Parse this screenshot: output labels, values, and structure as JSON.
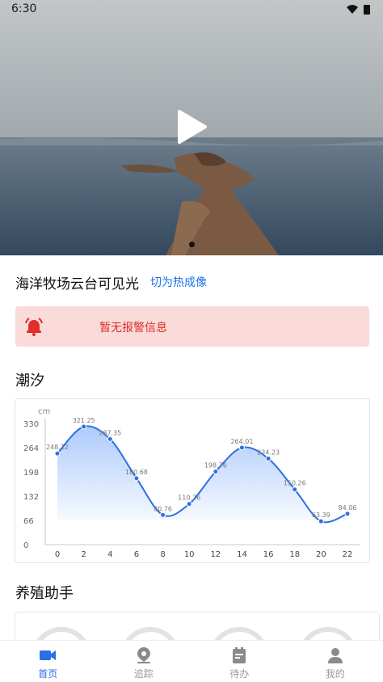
{
  "status_bar": {
    "time": "6:30"
  },
  "camera": {
    "title": "海洋牧场云台可见光",
    "switch_label": "切为热成像"
  },
  "alarm": {
    "text": "暂无报警信息",
    "icon": "alarm-bell-icon",
    "color": "#d93025",
    "bg": "#fbdada"
  },
  "tide": {
    "title": "潮汐"
  },
  "chart_data": {
    "type": "area",
    "ylabel": "cm",
    "ylim": [
      0,
      330
    ],
    "yticks": [
      "330",
      "264",
      "198",
      "132",
      "66",
      "0"
    ],
    "x": [
      "0",
      "2",
      "4",
      "6",
      "8",
      "10",
      "12",
      "14",
      "16",
      "18",
      "20",
      "22"
    ],
    "values": [
      248.12,
      321.25,
      287.35,
      180.68,
      80.76,
      110.76,
      198.76,
      264.01,
      234.23,
      150.26,
      63.39,
      84.06
    ],
    "labels": [
      "248.12",
      "321.25",
      "287.35",
      "180.68",
      "80.76",
      "110.76",
      "198.76",
      "264.01",
      "234.23",
      "150.26",
      "63.39",
      "84.06"
    ],
    "line_color": "#2f6fe0",
    "fill_color": "#a9c8fb"
  },
  "farm_assistant": {
    "title": "养殖助手"
  },
  "nav": [
    {
      "label": "首页",
      "icon": "video-camera-icon",
      "active": true
    },
    {
      "label": "追踪",
      "icon": "location-pin-icon",
      "active": false
    },
    {
      "label": "待办",
      "icon": "todo-list-icon",
      "active": false
    },
    {
      "label": "我的",
      "icon": "user-profile-icon",
      "active": false
    }
  ]
}
